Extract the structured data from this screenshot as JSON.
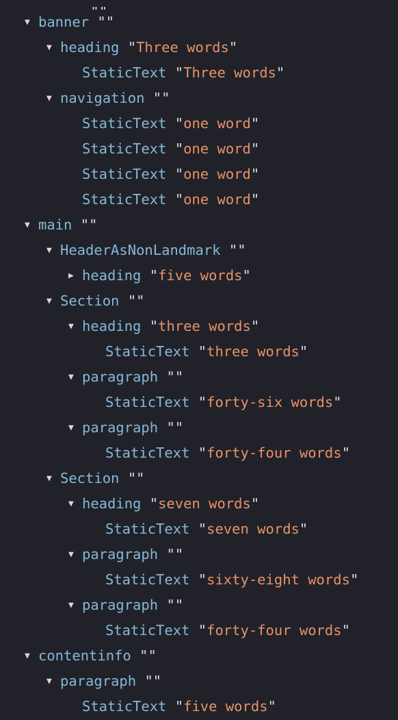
{
  "view": {
    "name": "accessibility-tree",
    "background_color": "#212229",
    "role_color": "#85b8da",
    "string_color": "#e99268",
    "quote_color": "#d9dbde",
    "twisty_color": "#d6d8dc"
  },
  "glyphs": {
    "expanded": "▼",
    "collapsed": "▶",
    "quote": "\""
  },
  "nodes": [
    {
      "id": "clipped-top",
      "level": 3,
      "twisty": "none",
      "role": "",
      "value": "",
      "clipped": true
    },
    {
      "id": "banner",
      "level": 1,
      "twisty": "expanded",
      "role": "banner",
      "value": ""
    },
    {
      "id": "banner-heading",
      "level": 2,
      "twisty": "expanded",
      "role": "heading",
      "value": "Three words"
    },
    {
      "id": "banner-heading-statictext",
      "level": 3,
      "twisty": "none",
      "role": "StaticText",
      "value": "Three words"
    },
    {
      "id": "navigation",
      "level": 2,
      "twisty": "expanded",
      "role": "navigation",
      "value": ""
    },
    {
      "id": "nav-statictext-1",
      "level": 3,
      "twisty": "none",
      "role": "StaticText",
      "value": "one word"
    },
    {
      "id": "nav-statictext-2",
      "level": 3,
      "twisty": "none",
      "role": "StaticText",
      "value": "one word"
    },
    {
      "id": "nav-statictext-3",
      "level": 3,
      "twisty": "none",
      "role": "StaticText",
      "value": "one word"
    },
    {
      "id": "nav-statictext-4",
      "level": 3,
      "twisty": "none",
      "role": "StaticText",
      "value": "one word"
    },
    {
      "id": "main",
      "level": 1,
      "twisty": "expanded",
      "role": "main",
      "value": ""
    },
    {
      "id": "header-as-non-landmark",
      "level": 2,
      "twisty": "expanded",
      "role": "HeaderAsNonLandmark",
      "value": ""
    },
    {
      "id": "main-heading-collapsed",
      "level": 3,
      "twisty": "collapsed",
      "role": "heading",
      "value": "five words"
    },
    {
      "id": "section-1",
      "level": 2,
      "twisty": "expanded",
      "role": "Section",
      "value": ""
    },
    {
      "id": "section-1-heading",
      "level": 3,
      "twisty": "expanded",
      "role": "heading",
      "value": "three words"
    },
    {
      "id": "section-1-heading-statictext",
      "level": 4,
      "twisty": "none",
      "role": "StaticText",
      "value": "three words"
    },
    {
      "id": "section-1-paragraph-1",
      "level": 3,
      "twisty": "expanded",
      "role": "paragraph",
      "value": ""
    },
    {
      "id": "section-1-paragraph-1-statictext",
      "level": 4,
      "twisty": "none",
      "role": "StaticText",
      "value": "forty-six words"
    },
    {
      "id": "section-1-paragraph-2",
      "level": 3,
      "twisty": "expanded",
      "role": "paragraph",
      "value": ""
    },
    {
      "id": "section-1-paragraph-2-statictext",
      "level": 4,
      "twisty": "none",
      "role": "StaticText",
      "value": "forty-four words"
    },
    {
      "id": "section-2",
      "level": 2,
      "twisty": "expanded",
      "role": "Section",
      "value": ""
    },
    {
      "id": "section-2-heading",
      "level": 3,
      "twisty": "expanded",
      "role": "heading",
      "value": "seven words"
    },
    {
      "id": "section-2-heading-statictext",
      "level": 4,
      "twisty": "none",
      "role": "StaticText",
      "value": "seven words"
    },
    {
      "id": "section-2-paragraph-1",
      "level": 3,
      "twisty": "expanded",
      "role": "paragraph",
      "value": ""
    },
    {
      "id": "section-2-paragraph-1-statictext",
      "level": 4,
      "twisty": "none",
      "role": "StaticText",
      "value": "sixty-eight words"
    },
    {
      "id": "section-2-paragraph-2",
      "level": 3,
      "twisty": "expanded",
      "role": "paragraph",
      "value": ""
    },
    {
      "id": "section-2-paragraph-2-statictext",
      "level": 4,
      "twisty": "none",
      "role": "StaticText",
      "value": "forty-four words"
    },
    {
      "id": "contentinfo",
      "level": 1,
      "twisty": "expanded",
      "role": "contentinfo",
      "value": ""
    },
    {
      "id": "contentinfo-paragraph",
      "level": 2,
      "twisty": "expanded",
      "role": "paragraph",
      "value": ""
    },
    {
      "id": "contentinfo-paragraph-statictext",
      "level": 3,
      "twisty": "none",
      "role": "StaticText",
      "value": "five words"
    }
  ]
}
